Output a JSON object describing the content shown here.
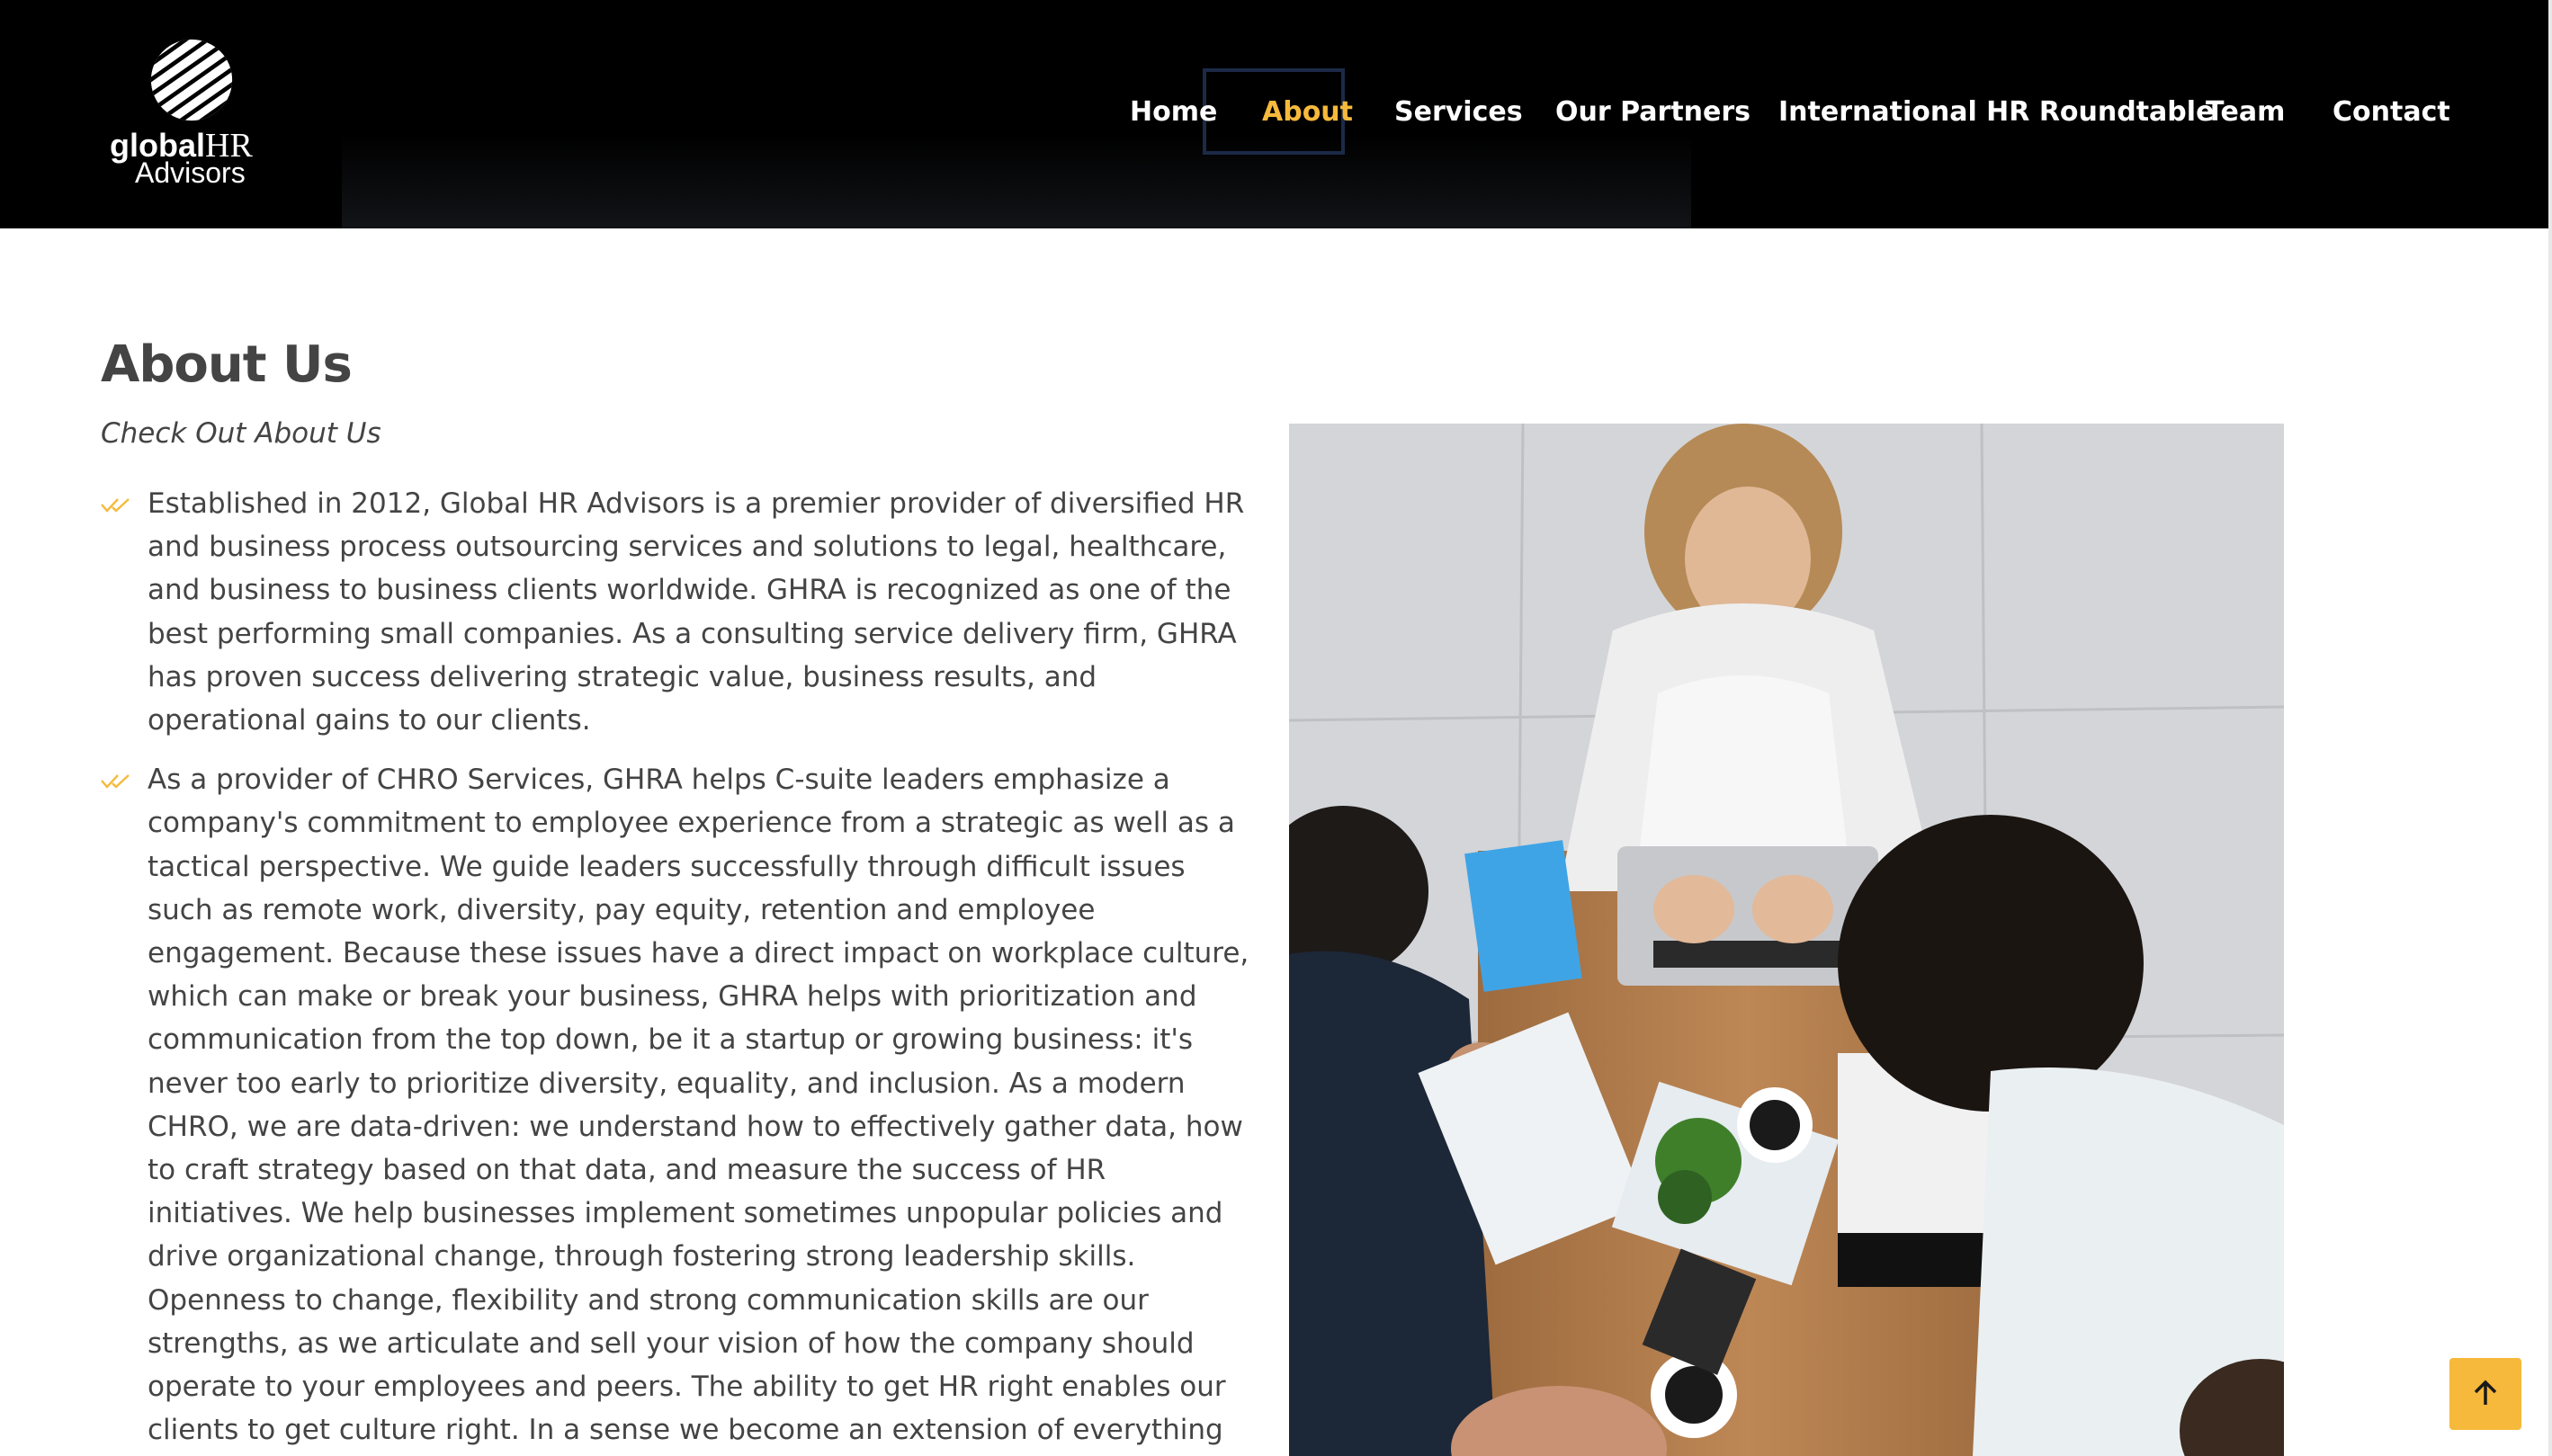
{
  "brand": {
    "logo_line1_bold": "global",
    "logo_line1_hr": "HR",
    "logo_line2": "Advisors"
  },
  "nav": {
    "items": [
      {
        "label": "Home",
        "active": false
      },
      {
        "label": "About",
        "active": true
      },
      {
        "label": "Services",
        "active": false
      },
      {
        "label": "Our Partners",
        "active": false
      },
      {
        "label": "International HR Roundtable",
        "active": false
      },
      {
        "label": "Team",
        "active": false
      },
      {
        "label": "Contact",
        "active": false
      }
    ]
  },
  "about": {
    "title": "About Us",
    "subtitle": "Check Out About Us",
    "bullets": [
      "Established in 2012, Global HR Advisors is a premier provider of diversified HR and business process outsourcing services and solutions to legal, healthcare, and business to business clients worldwide. GHRA is recognized as one of the best performing small companies. As a consulting service delivery firm, GHRA has proven success delivering strategic value, business results, and operational gains to our clients.",
      "As a provider of CHRO Services, GHRA helps C-suite leaders emphasize a company's commitment to employee experience from a strategic as well as a tactical perspective. We guide leaders successfully through difficult issues such as remote work, diversity, pay equity, retention and employee engagement. Because these issues have a direct impact on workplace culture, which can make or break your business, GHRA helps with prioritization and communication from the top down, be it a startup or growing business: it's never too early to prioritize diversity, equality, and inclusion. As a modern CHRO, we are data-driven: we understand how to effectively gather data, how to craft strategy based on that data, and measure the success of HR initiatives. We help businesses implement sometimes unpopular policies and drive organizational change, through fostering strong leadership skills. Openness to change, flexibility and strong communication skills are our strengths, as we articulate and sell your vision of how the company should operate to your employees and peers. The ability to get HR right enables our clients to get culture right. In a sense we become an extension of everything good that happens within the client's company."
    ]
  },
  "colors": {
    "accent": "#f6b93b",
    "header_bg": "#000000",
    "text": "#444444"
  },
  "icons": {
    "bullet": "double-check-icon",
    "back_to_top": "arrow-up-icon",
    "logo": "striped-globe-icon"
  }
}
